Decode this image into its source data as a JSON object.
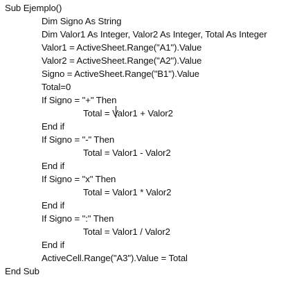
{
  "document": {
    "lines": [
      "Sub Ejemplo()",
      "Dim Signo As String",
      "Dim Valor1 As Integer, Valor2 As Integer, Total As Integer",
      "Valor1 = ActiveSheet.Range(\"A1\").Value",
      "Valor2 = ActiveSheet.Range(\"A2\").Value",
      "Signo = ActiveSheet.Range(\"B1\").Value",
      "Total=0",
      "If Signo = \"+\" Then",
      "Total = Valor1 + Valor2",
      "End if",
      "If Signo = \"-\" Then",
      "Total = Valor1 - Valor2",
      "End if",
      "If Signo = \"x\" Then",
      "Total = Valor1 * Valor2",
      "End if",
      "If Signo = \":\" Then",
      "Total = Valor1 / Valor2",
      "End if",
      "ActiveCell.Range(\"A3\").Value = Total",
      "End Sub"
    ]
  }
}
